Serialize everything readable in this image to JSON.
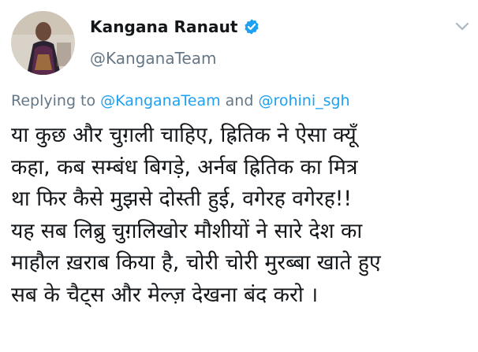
{
  "author": {
    "display_name": "Kangana Ranaut",
    "handle": "@KanganaTeam",
    "verified": true,
    "avatar_icon": "profile-photo"
  },
  "reply": {
    "prefix": "Replying to",
    "mention1": "@KanganaTeam",
    "conjunction": "and",
    "mention2": "@rohini_sgh"
  },
  "tweet": {
    "lines": [
      "या कुछ और चुग़ली चाहिए, ह्रितिक ने ऐसा क्यूँ",
      "कहा, कब सम्बंध बिगड़े, अर्नब ह्रितिक का मित्र",
      "था फिर कैसे मुझसे दोस्ती हुई, वगेरह वगेरह!!",
      "यह सब लिब्रु चुग़लिखोर मौशीयों ने सारे देश का",
      "माहौल ख़राब किया है, चोरी चोरी मुरब्बा खाते हुए",
      "सब के चैट्स और मेल्ज़ देखना बंद करो ।"
    ]
  },
  "colors": {
    "text": "#14171a",
    "secondary": "#657786",
    "accent": "#1da1f2"
  },
  "icons": {
    "verified": "verified-badge-icon",
    "menu": "chevron-down-icon"
  }
}
